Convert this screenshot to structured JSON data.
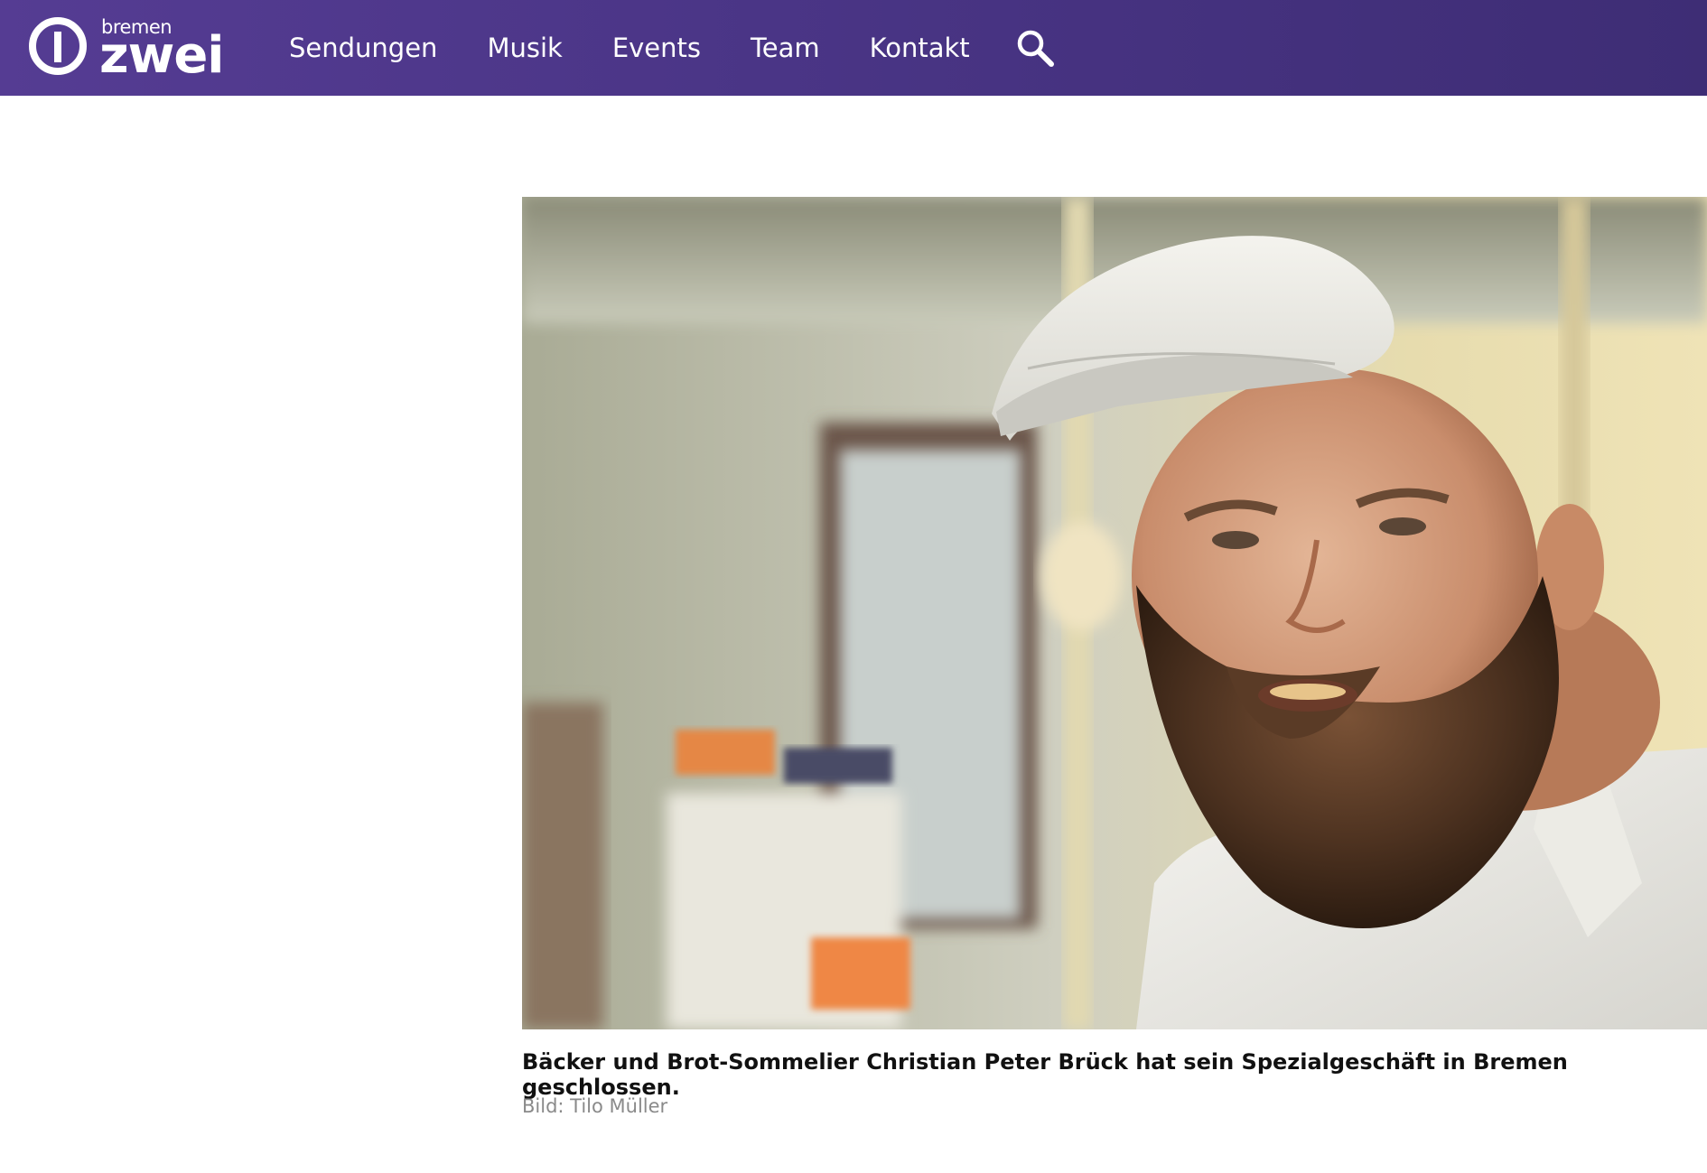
{
  "header": {
    "logo": {
      "small": "bremen",
      "big": "zwei"
    },
    "nav": [
      {
        "label": "Sendungen"
      },
      {
        "label": "Musik"
      },
      {
        "label": "Events"
      },
      {
        "label": "Team"
      },
      {
        "label": "Kontakt"
      }
    ],
    "search_icon": "search-icon"
  },
  "article": {
    "image_alt": "Christian Peter Brück",
    "caption": "Bäcker und Brot-Sommelier Christian Peter Brück hat sein Spezialgeschäft in Bremen geschlossen.",
    "credit": "Bild: Tilo Müller"
  },
  "colors": {
    "header_bg": "#4a3586",
    "caption_text": "#111111",
    "credit_text": "#8a8a8a"
  }
}
